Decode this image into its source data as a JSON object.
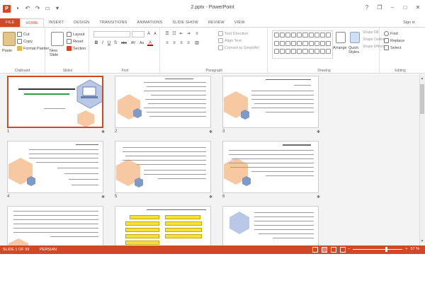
{
  "titlebar": {
    "app_icon_letter": "P",
    "title": "2.pptx - PowerPoint",
    "help": "?",
    "restore": "❐",
    "minimize": "–",
    "maximize": "□",
    "close": "✕"
  },
  "tabs": {
    "file": "FILE",
    "home": "HOME",
    "insert": "INSERT",
    "design": "DESIGN",
    "transitions": "TRANSITIONS",
    "animations": "ANIMATIONS",
    "slideshow": "SLIDE SHOW",
    "review": "REVIEW",
    "view": "VIEW",
    "signin": "Sign in"
  },
  "ribbon": {
    "clipboard": {
      "label": "Clipboard",
      "paste": "Paste",
      "cut": "Cut",
      "copy": "Copy",
      "format_painter": "Format Painter"
    },
    "slides": {
      "label": "Slides",
      "new_slide": "New Slide",
      "layout": "Layout",
      "reset": "Reset",
      "section": "Section"
    },
    "font": {
      "label": "Font",
      "bold": "B",
      "italic": "I",
      "underline": "U",
      "shadow": "S",
      "strike": "abc",
      "spacing": "AV",
      "case": "Aa",
      "grow": "A",
      "shrink": "A"
    },
    "paragraph": {
      "label": "Paragraph",
      "text_direction": "Text Direction",
      "align_text": "Align Text",
      "smartart": "Convert to SmartArt"
    },
    "drawing": {
      "label": "Drawing",
      "arrange": "Arrange",
      "quick_styles": "Quick Styles",
      "shape_fill": "Shape Fill",
      "shape_outline": "Shape Outline",
      "shape_effects": "Shape Effects"
    },
    "editing": {
      "label": "Editing",
      "find": "Find",
      "replace": "Replace",
      "select": "Select"
    }
  },
  "slides": [
    {
      "num": "1"
    },
    {
      "num": "2"
    },
    {
      "num": "3"
    },
    {
      "num": "4"
    },
    {
      "num": "5"
    },
    {
      "num": "6"
    },
    {
      "num": ""
    },
    {
      "num": ""
    },
    {
      "num": ""
    }
  ],
  "status": {
    "slide_of": "SLIDE 1 OF 39",
    "language": "PERSIAN",
    "zoom_minus": "–",
    "zoom_plus": "+",
    "zoom": "57 %"
  },
  "colors": {
    "accent": "#d24726",
    "hex_orange": "#f6c9a3",
    "hex_blue": "#7f9ac6",
    "highlight_yellow": "#f4e23a"
  }
}
